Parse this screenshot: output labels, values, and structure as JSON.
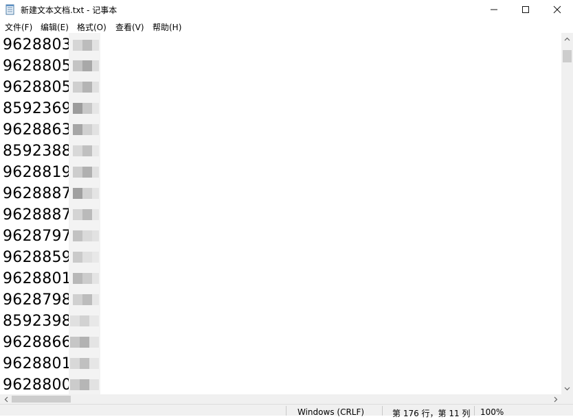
{
  "window": {
    "title": "新建文本文档.txt - 记事本",
    "minimize_icon": "minimize-icon",
    "maximize_icon": "maximize-icon",
    "close_icon": "close-icon"
  },
  "menu": [
    "文件(F)",
    "编辑(E)",
    "格式(O)",
    "查看(V)",
    "帮助(H)"
  ],
  "lines": [
    {
      "visible": "962880356",
      "tail": "2"
    },
    {
      "visible": "962880561",
      "tail": "2"
    },
    {
      "visible": "962880591",
      "tail": "2"
    },
    {
      "visible": "85923694",
      "tail": ""
    },
    {
      "visible": "96288634",
      "tail": "3"
    },
    {
      "visible": "85923880",
      "tail": ""
    },
    {
      "visible": "96288196",
      "tail": "3"
    },
    {
      "visible": "96288879",
      "tail": "3"
    },
    {
      "visible": "96288875",
      "tail": "3"
    },
    {
      "visible": "96287975",
      "tail": "2"
    },
    {
      "visible": "96288595",
      "tail": "3"
    },
    {
      "visible": "96288014",
      "tail": "2"
    },
    {
      "visible": "96287982",
      "tail": "2"
    },
    {
      "visible": "8592398",
      "tail": "1"
    },
    {
      "visible": "9628866",
      "tail": "3"
    },
    {
      "visible": "9628801",
      "tail": "3"
    },
    {
      "visible": "9628800",
      "tail": "3"
    }
  ],
  "status": {
    "encoding": "Windows (CRLF)",
    "position": "第 176 行，第 11 列",
    "zoom": "100%"
  }
}
